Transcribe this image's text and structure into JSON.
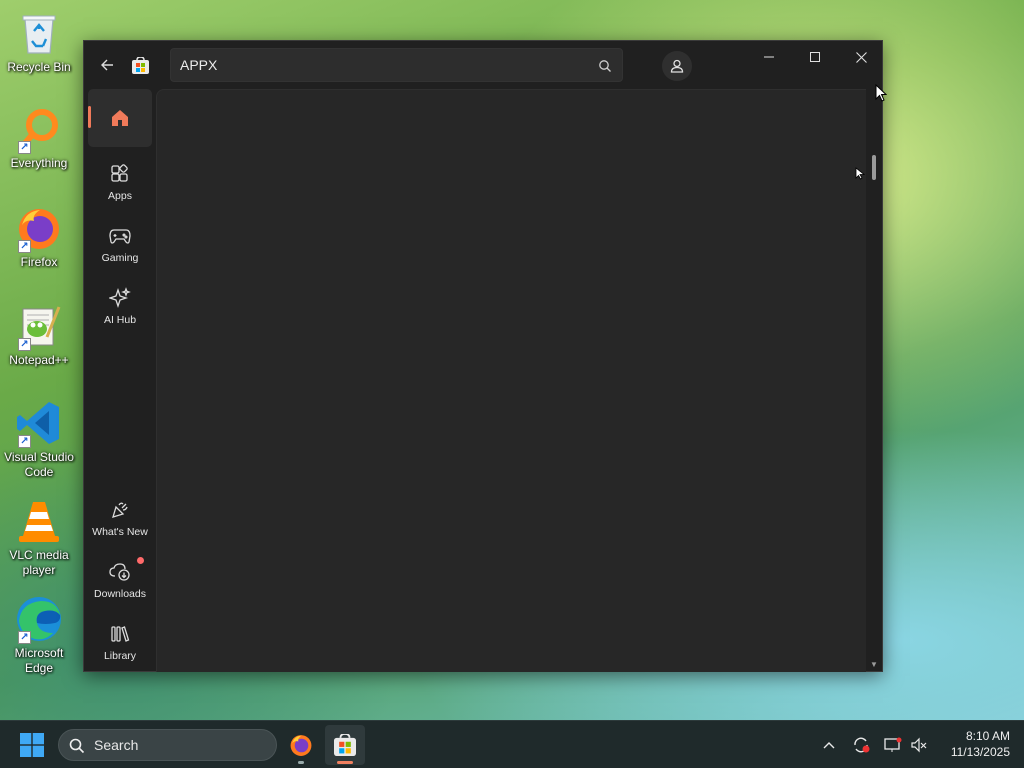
{
  "desktop": {
    "icons": [
      {
        "label_line1": "Recycle Bin",
        "label_line2": ""
      },
      {
        "label_line1": "Everything",
        "label_line2": ""
      },
      {
        "label_line1": "Firefox",
        "label_line2": ""
      },
      {
        "label_line1": "Notepad++",
        "label_line2": ""
      },
      {
        "label_line1": "Visual Studio",
        "label_line2": "Code"
      },
      {
        "label_line1": "VLC media",
        "label_line2": "player"
      },
      {
        "label_line1": "Microsoft",
        "label_line2": "Edge"
      }
    ]
  },
  "store": {
    "search": {
      "value": "APPX"
    },
    "nav": [
      {
        "label": "",
        "icon": "home-icon",
        "active": true
      },
      {
        "label": "Apps",
        "icon": "apps-icon"
      },
      {
        "label": "Gaming",
        "icon": "gamepad-icon"
      },
      {
        "label": "AI Hub",
        "icon": "sparkle-icon"
      },
      {
        "label": "What's New",
        "icon": "megaphone-icon"
      },
      {
        "label": "Downloads",
        "icon": "download-cloud-icon"
      },
      {
        "label": "Library",
        "icon": "library-icon"
      }
    ],
    "accent_color": "#f07a5a"
  },
  "taskbar": {
    "search_label": "Search",
    "time": "8:10 AM",
    "date": "11/13/2025"
  }
}
